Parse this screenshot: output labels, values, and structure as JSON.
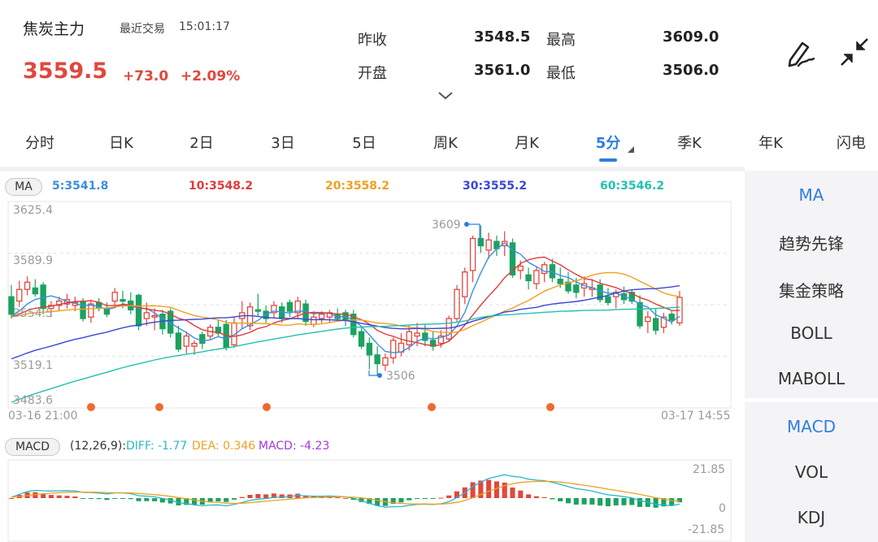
{
  "header": {
    "name": "焦炭主力",
    "last_trade_label": "最近交易",
    "last_trade_time": "15:01:17",
    "price": "3559.5",
    "change": "+73.0",
    "change_pct": "+2.09%",
    "prev_close_label": "昨收",
    "prev_close": "3548.5",
    "high_label": "最高",
    "high": "3609.0",
    "open_label": "开盘",
    "open": "3561.0",
    "low_label": "最低",
    "low": "3506.0",
    "icons": [
      "pen-icon",
      "collapse-icon",
      "chevron-down-icon"
    ]
  },
  "tabs": [
    "分时",
    "日K",
    "2日",
    "3日",
    "5日",
    "周K",
    "月K",
    "5分",
    "季K",
    "年K",
    "闪电"
  ],
  "active_tab": "5分",
  "side_menu": {
    "main": [
      "MA",
      "趋势先锋",
      "集金策略",
      "BOLL",
      "MABOLL"
    ],
    "sub": [
      "MACD",
      "VOL",
      "KDJ"
    ],
    "active_main": "MA",
    "active_sub": "MACD"
  },
  "colors": {
    "up": "#e0473d",
    "down": "#1aa260",
    "accent": "#2f7de1",
    "ma5": "#3b8fe0",
    "ma10": "#e03b3b",
    "ma20": "#f0a020",
    "ma30": "#3a46d6",
    "ma60": "#23c0b0",
    "diff": "#28b8c8",
    "dea": "#f0a020",
    "macd": "#a23bd6"
  },
  "chart_data": [
    {
      "type": "candlestick",
      "indicator_label": "MA",
      "legend": [
        {
          "name": "5",
          "value": "3541.8",
          "text": "5:3541.8"
        },
        {
          "name": "10",
          "value": "3548.2",
          "text": "10:3548.2"
        },
        {
          "name": "20",
          "value": "3558.2",
          "text": "20:3558.2"
        },
        {
          "name": "30",
          "value": "3555.2",
          "text": "30:3555.2"
        },
        {
          "name": "60",
          "value": "3546.2",
          "text": "60:3546.2"
        }
      ],
      "y_ticks": [
        "3625.4",
        "3589.9",
        "3554.5",
        "3519.1",
        "3483.6"
      ],
      "ylim": [
        3483.6,
        3625.4
      ],
      "x_start_label": "03-16 21:00",
      "x_end_label": "03-17 14:55",
      "high_marker": "3609",
      "low_marker": "3506",
      "marker_dots": [
        9,
        17,
        29,
        47,
        60
      ],
      "ohlc": [
        [
          3560,
          3568,
          3545,
          3548
        ],
        [
          3557,
          3571,
          3553,
          3565
        ],
        [
          3565,
          3574,
          3561,
          3570
        ],
        [
          3566,
          3572,
          3560,
          3562
        ],
        [
          3568,
          3570,
          3548,
          3552
        ],
        [
          3552,
          3557,
          3546,
          3554
        ],
        [
          3554,
          3560,
          3550,
          3557
        ],
        [
          3555,
          3562,
          3552,
          3558
        ],
        [
          3554,
          3560,
          3550,
          3556
        ],
        [
          3557,
          3559,
          3543,
          3545
        ],
        [
          3546,
          3558,
          3542,
          3555
        ],
        [
          3556,
          3559,
          3550,
          3552
        ],
        [
          3552,
          3556,
          3546,
          3548
        ],
        [
          3557,
          3566,
          3552,
          3563
        ],
        [
          3558,
          3564,
          3552,
          3557
        ],
        [
          3557,
          3563,
          3548,
          3551
        ],
        [
          3561,
          3562,
          3537,
          3540
        ],
        [
          3545,
          3556,
          3540,
          3549
        ],
        [
          3546,
          3552,
          3537,
          3547
        ],
        [
          3548,
          3551,
          3534,
          3538
        ],
        [
          3550,
          3552,
          3532,
          3535
        ],
        [
          3535,
          3540,
          3522,
          3524
        ],
        [
          3526,
          3536,
          3521,
          3533
        ],
        [
          3526,
          3530,
          3520,
          3528
        ],
        [
          3534,
          3536,
          3524,
          3528
        ],
        [
          3533,
          3541,
          3531,
          3539
        ],
        [
          3539,
          3544,
          3533,
          3535
        ],
        [
          3541,
          3544,
          3523,
          3525
        ],
        [
          3527,
          3546,
          3525,
          3542
        ],
        [
          3545,
          3557,
          3538,
          3549
        ],
        [
          3540,
          3556,
          3537,
          3553
        ],
        [
          3551,
          3562,
          3547,
          3550
        ],
        [
          3550,
          3554,
          3542,
          3545
        ],
        [
          3549,
          3557,
          3545,
          3554
        ],
        [
          3553,
          3556,
          3542,
          3545
        ],
        [
          3556,
          3558,
          3546,
          3550
        ],
        [
          3549,
          3560,
          3545,
          3557
        ],
        [
          3555,
          3558,
          3540,
          3543
        ],
        [
          3541,
          3550,
          3539,
          3546
        ],
        [
          3545,
          3550,
          3542,
          3548
        ],
        [
          3546,
          3551,
          3542,
          3549
        ],
        [
          3548,
          3552,
          3543,
          3545
        ],
        [
          3549,
          3551,
          3540,
          3544
        ],
        [
          3548,
          3551,
          3532,
          3534
        ],
        [
          3536,
          3539,
          3524,
          3526
        ],
        [
          3528,
          3532,
          3510,
          3520
        ],
        [
          3520,
          3526,
          3506,
          3514
        ],
        [
          3513,
          3521,
          3509,
          3518
        ],
        [
          3518,
          3532,
          3514,
          3530
        ],
        [
          3522,
          3535,
          3519,
          3528
        ],
        [
          3527,
          3540,
          3523,
          3536
        ],
        [
          3533,
          3542,
          3526,
          3535
        ],
        [
          3535,
          3541,
          3526,
          3530
        ],
        [
          3530,
          3536,
          3523,
          3526
        ],
        [
          3528,
          3537,
          3525,
          3533
        ],
        [
          3531,
          3547,
          3529,
          3545
        ],
        [
          3545,
          3568,
          3543,
          3565
        ],
        [
          3560,
          3580,
          3555,
          3577
        ],
        [
          3578,
          3602,
          3570,
          3600
        ],
        [
          3600,
          3609,
          3590,
          3595
        ],
        [
          3592,
          3604,
          3586,
          3599
        ],
        [
          3598,
          3602,
          3588,
          3593
        ],
        [
          3595,
          3605,
          3588,
          3598
        ],
        [
          3597,
          3600,
          3573,
          3575
        ],
        [
          3578,
          3585,
          3572,
          3581
        ],
        [
          3575,
          3580,
          3565,
          3571
        ],
        [
          3569,
          3581,
          3565,
          3578
        ],
        [
          3576,
          3584,
          3570,
          3582
        ],
        [
          3582,
          3586,
          3570,
          3573
        ],
        [
          3572,
          3580,
          3566,
          3569
        ],
        [
          3570,
          3577,
          3562,
          3564
        ],
        [
          3568,
          3573,
          3559,
          3563
        ],
        [
          3566,
          3574,
          3560,
          3569
        ],
        [
          3565,
          3572,
          3560,
          3566
        ],
        [
          3568,
          3572,
          3556,
          3558
        ],
        [
          3560,
          3566,
          3554,
          3556
        ],
        [
          3560,
          3565,
          3552,
          3563
        ],
        [
          3562,
          3567,
          3555,
          3558
        ],
        [
          3563,
          3565,
          3555,
          3557
        ],
        [
          3556,
          3561,
          3538,
          3540
        ],
        [
          3543,
          3550,
          3535,
          3546
        ],
        [
          3545,
          3552,
          3534,
          3537
        ],
        [
          3539,
          3549,
          3535,
          3546
        ],
        [
          3548,
          3550,
          3541,
          3544
        ],
        [
          3542,
          3564,
          3540,
          3559.5
        ]
      ]
    },
    {
      "type": "macd",
      "params": "(12,26,9):",
      "legend": [
        {
          "name": "DIFF",
          "value": "-1.77",
          "text": "DIFF: -1.77"
        },
        {
          "name": "DEA",
          "value": "0.346",
          "text": "DEA: 0.346"
        },
        {
          "name": "MACD",
          "value": "-4.23",
          "text": "MACD: -4.23"
        }
      ],
      "y_ticks": [
        "21.85",
        "0",
        "-21.85"
      ],
      "ylim": [
        -21.85,
        21.85
      ]
    }
  ]
}
